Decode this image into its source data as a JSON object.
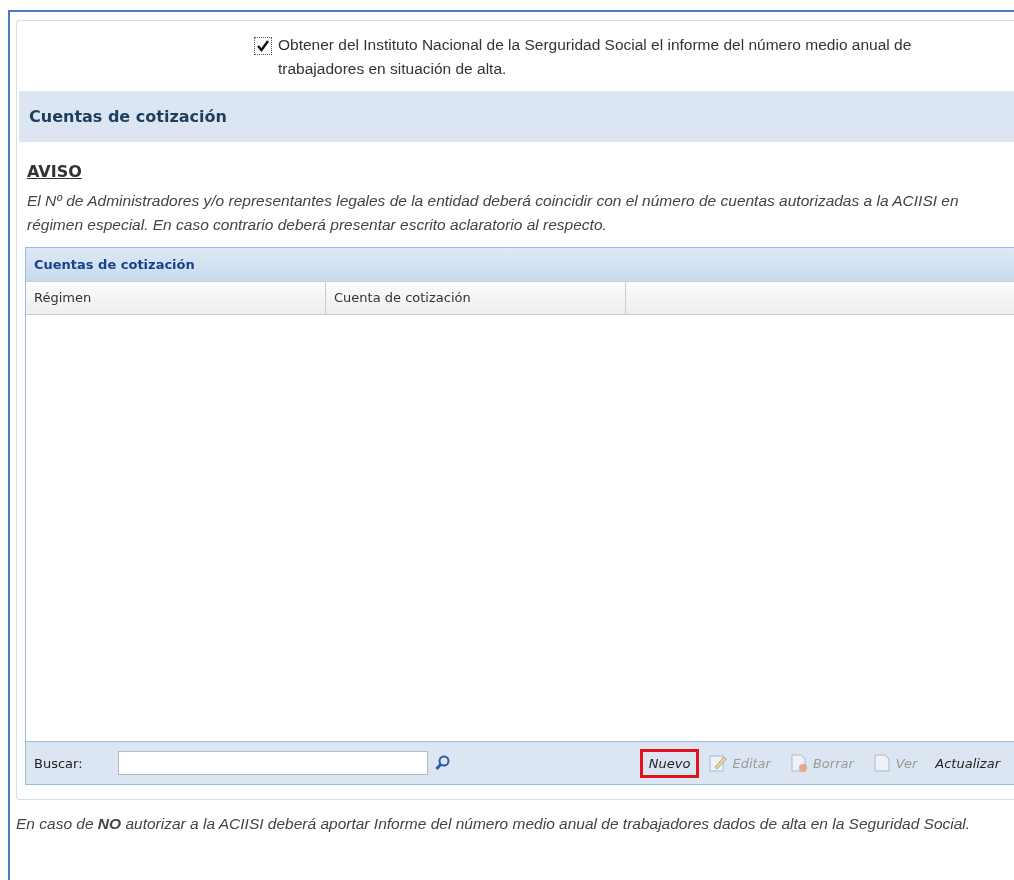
{
  "consent": {
    "checked": true,
    "label": "Obtener del Instituto Nacional de la Serguridad Social el informe del número medio anual de trabajadores en situación de alta."
  },
  "section": {
    "title": "Cuentas de cotización"
  },
  "notice": {
    "title": "AVISO",
    "text": "El Nº de Administradores y/o representantes legales de la entidad deberá coincidir con el número de cuentas autorizadas a la ACIISI en régimen especial. En caso contrario deberá presentar escrito aclaratorio al respecto."
  },
  "grid": {
    "title": "Cuentas de cotización",
    "columns": [
      "Régimen",
      "Cuenta de cotización"
    ],
    "search_label": "Buscar:",
    "actions": [
      {
        "label": "Nuevo",
        "kind": "plain",
        "disabled": false,
        "highlighted": true
      },
      {
        "label": "Editar",
        "kind": "edit",
        "disabled": true,
        "highlighted": false
      },
      {
        "label": "Borrar",
        "kind": "delete",
        "disabled": true,
        "highlighted": false
      },
      {
        "label": "Ver",
        "kind": "view",
        "disabled": true,
        "highlighted": false
      },
      {
        "label": "Actualizar",
        "kind": "plain",
        "disabled": false,
        "highlighted": false
      }
    ]
  },
  "footer_note": "En caso de **NO** autorizar a la ACIISI deberá aportar Informe del número medio anual de trabajadores dados de alta en la Seguridad Social."
}
